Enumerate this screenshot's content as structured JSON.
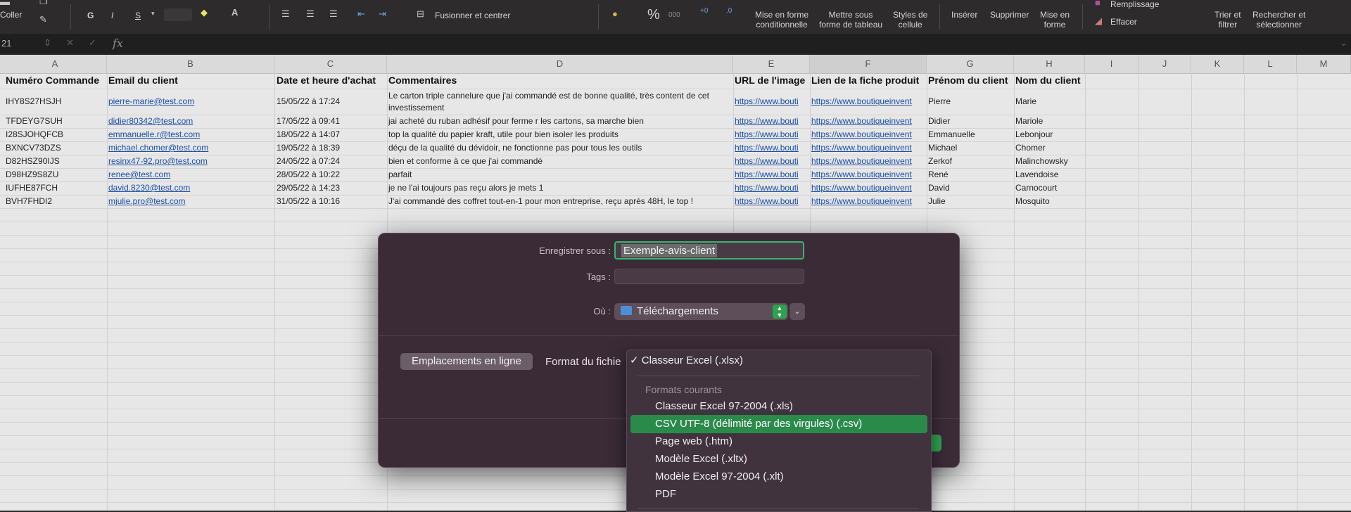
{
  "ribbon": {
    "paste_label": "Coller",
    "bold": "G",
    "italic": "I",
    "underline": "S",
    "merge_label": "Fusionner et centrer",
    "percent": "%",
    "thousands": "000",
    "cond_format": [
      "Mise en forme",
      "conditionnelle"
    ],
    "table_format": [
      "Mettre sous",
      "forme de tableau"
    ],
    "cell_styles": [
      "Styles de",
      "cellule"
    ],
    "insert": "Insérer",
    "delete": "Supprimer",
    "format": [
      "Mise en",
      "forme"
    ],
    "fill": "Remplissage",
    "clear": "Effacer",
    "sort": [
      "Trier et",
      "filtrer"
    ],
    "find": [
      "Rechercher et",
      "sélectionner"
    ]
  },
  "formula_bar": {
    "cell_ref": "21",
    "fx": "fx"
  },
  "sheet": {
    "columns": [
      "A",
      "B",
      "C",
      "D",
      "E",
      "F",
      "G",
      "H",
      "I",
      "J",
      "K",
      "L",
      "M"
    ],
    "headers": [
      "Numéro Commande",
      "Email du client",
      "Date et heure d'achat",
      "Commentaires",
      "URL de l'image",
      "Lien de la fiche produit",
      "Prénom du client",
      "Nom du client"
    ],
    "rows": [
      {
        "num": "IHY8S27HSJH",
        "email": "pierre-marie@test.com",
        "date": "15/05/22 à 17:24",
        "comment": "Le carton triple cannelure que j'ai commandé est de bonne qualité, très content de cet investissement",
        "url": "https://www.bouti",
        "link": "https://www.boutiqueinvent",
        "first": "Pierre",
        "last": "Marie"
      },
      {
        "num": "TFDEYG7SUH",
        "email": "didier80342@test.com",
        "date": "17/05/22 à 09:41",
        "comment": "jai acheté du ruban adhésif pour ferme r les cartons, sa marche bien",
        "url": "https://www.bouti",
        "link": "https://www.boutiqueinvent",
        "first": "Didier",
        "last": "Mariole"
      },
      {
        "num": "I28SJOHQFCB",
        "email": "emmanuelle.r@test.com",
        "date": "18/05/22 à 14:07",
        "comment": "top la qualité du papier kraft, utile pour bien isoler les produits",
        "url": "https://www.bouti",
        "link": "https://www.boutiqueinvent",
        "first": "Emmanuelle",
        "last": "Lebonjour"
      },
      {
        "num": "BXNCV73DZS",
        "email": "michael.chomer@test.com",
        "date": "19/05/22 à 18:39",
        "comment": "déçu de la qualité du dévidoir, ne fonctionne pas pour tous les outils",
        "url": "https://www.bouti",
        "link": "https://www.boutiqueinvent",
        "first": "Michael",
        "last": "Chomer"
      },
      {
        "num": "D82HSZ90IJS",
        "email": "resinx47-92.pro@test.com",
        "date": "24/05/22 à 07:24",
        "comment": "bien et conforme à ce que j'ai commandé",
        "url": "https://www.bouti",
        "link": "https://www.boutiqueinvent",
        "first": "Zerkof",
        "last": "Malinchowsky"
      },
      {
        "num": "D98HZ9S8ZU",
        "email": "renee@test.com",
        "date": "28/05/22 à 10:22",
        "comment": "parfait",
        "url": "https://www.bouti",
        "link": "https://www.boutiqueinvent",
        "first": "René",
        "last": "Lavendoise"
      },
      {
        "num": "IUFHE87FCH",
        "email": "david.8230@test.com",
        "date": "29/05/22 à 14:23",
        "comment": "je ne l'ai toujours pas reçu alors je mets 1",
        "url": "https://www.bouti",
        "link": "https://www.boutiqueinvent",
        "first": "David",
        "last": "Carnocourt"
      },
      {
        "num": "BVH7FHDI2",
        "email": "mjulie.pro@test.com",
        "date": "31/05/22 à 10:16",
        "comment": "J'ai commandé des coffret tout-en-1 pour mon entreprise, reçu après 48H, le top !",
        "url": "https://www.bouti",
        "link": "https://www.boutiqueinvent",
        "first": "Julie",
        "last": "Mosquito"
      }
    ]
  },
  "dialog": {
    "save_as_label": "Enregistrer sous :",
    "filename": "Exemple-avis-client",
    "tags_label": "Tags :",
    "where_label": "Où :",
    "where_value": "Téléchargements",
    "online_button": "Emplacements en ligne",
    "format_label": "Format du fichie"
  },
  "format_menu": {
    "selected": "✓ Classeur Excel (.xlsx)",
    "group_label": "Formats courants",
    "items": [
      "Classeur Excel 97-2004 (.xls)",
      "CSV UTF-8 (délimité par des virgules) (.csv)",
      "Page web (.htm)",
      "Modèle Excel (.xltx)",
      "Modèle Excel 97-2004 (.xlt)",
      "PDF"
    ],
    "highlighted_index": 1
  }
}
